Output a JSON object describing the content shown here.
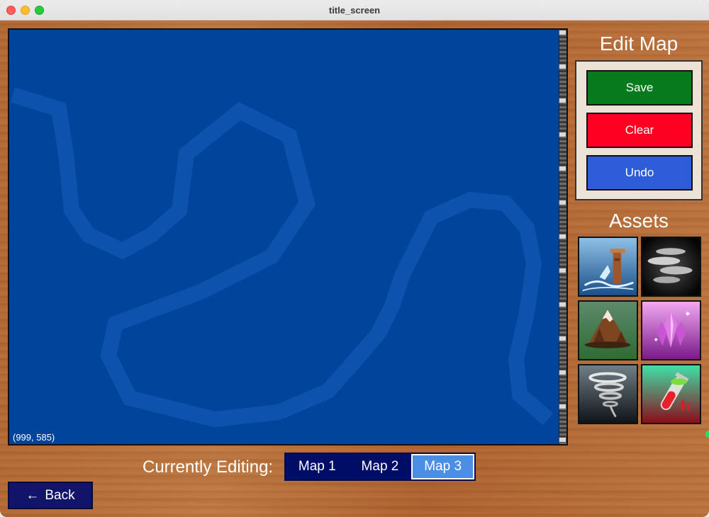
{
  "window": {
    "title": "title_screen"
  },
  "map": {
    "coords_readout": "(999, 585)"
  },
  "edit_panel": {
    "title": "Edit Map",
    "save_label": "Save",
    "clear_label": "Clear",
    "undo_label": "Undo"
  },
  "assets": {
    "title": "Assets",
    "items": [
      {
        "name": "waterfall-tower-icon"
      },
      {
        "name": "fog-clouds-icon"
      },
      {
        "name": "mountain-icon"
      },
      {
        "name": "crystal-icon"
      },
      {
        "name": "tornado-icon"
      },
      {
        "name": "potion-vial-icon"
      }
    ]
  },
  "footer": {
    "editing_label": "Currently Editing:",
    "tabs": [
      {
        "label": "Map 1",
        "active": false
      },
      {
        "label": "Map 2",
        "active": false
      },
      {
        "label": "Map 3",
        "active": true
      }
    ],
    "back_label": "Back",
    "back_arrow": "←"
  },
  "colors": {
    "map_bg": "#00449b",
    "save": "#077a1e",
    "clear": "#fd0022",
    "undo": "#2f5cd9",
    "tab_bar": "#000d66",
    "tab_active": "#4a8ee6"
  }
}
